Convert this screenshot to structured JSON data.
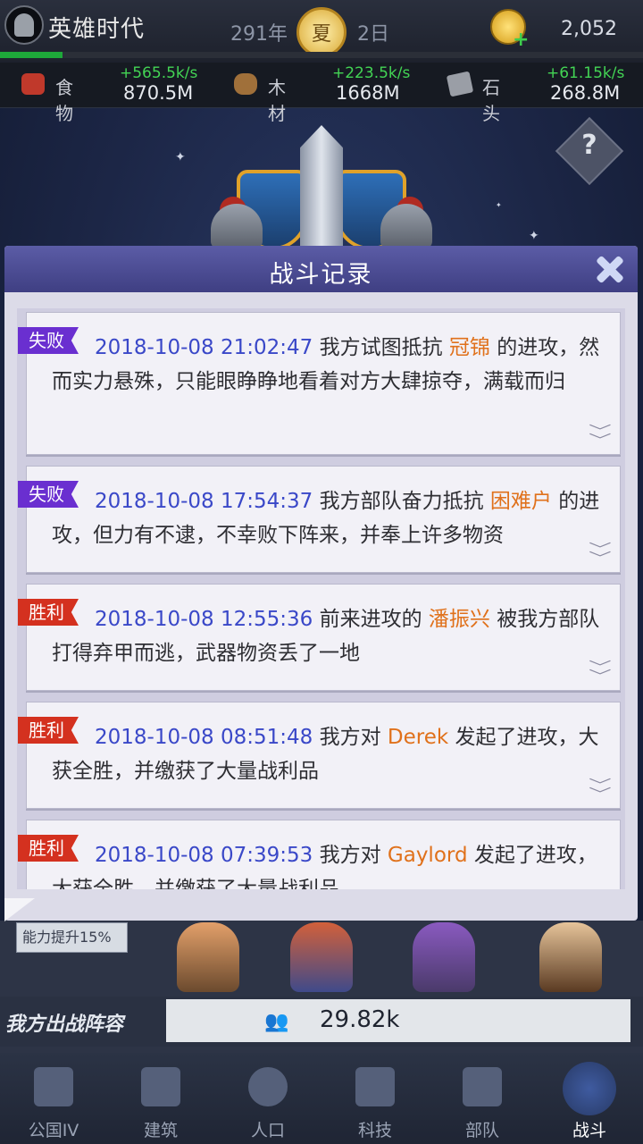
{
  "header": {
    "game_title": "英雄时代",
    "year": "291年",
    "season": "夏",
    "day": "2日",
    "gold": "2,052"
  },
  "resources": [
    {
      "name": "食物",
      "rate": "+565.5k/s",
      "amount": "870.5M",
      "icon": "food-icon"
    },
    {
      "name": "木材",
      "rate": "+223.5k/s",
      "amount": "1668M",
      "icon": "wood-icon"
    },
    {
      "name": "石头",
      "rate": "+61.15k/s",
      "amount": "268.8M",
      "icon": "stone-icon"
    }
  ],
  "help": {
    "label": "?"
  },
  "modal": {
    "title": "战斗记录",
    "entries": [
      {
        "result": "失败",
        "time": "2018-10-08 21:02:47",
        "pre": " 我方试图抵抗 ",
        "name": "冠锦",
        "post": " 的进攻，然而实力悬殊，只能眼睁睁地看着对方大肆掠夺，满载而归"
      },
      {
        "result": "失败",
        "time": "2018-10-08 17:54:37",
        "pre": " 我方部队奋力抵抗 ",
        "name": "困难户",
        "post": " 的进攻，但力有不逮，不幸败下阵来，并奉上许多物资"
      },
      {
        "result": "胜利",
        "time": "2018-10-08 12:55:36",
        "pre": " 前来进攻的 ",
        "name": "潘振兴",
        "post": " 被我方部队打得弃甲而逃，武器物资丢了一地"
      },
      {
        "result": "胜利",
        "time": "2018-10-08 08:51:48",
        "pre": " 我方对 ",
        "name": "Derek",
        "post": " 发起了进攻，大获全胜，并缴获了大量战利品"
      },
      {
        "result": "胜利",
        "time": "2018-10-08 07:39:53",
        "pre": " 我方对 ",
        "name": "Gaylord",
        "post": " 发起了进攻，大获全胜，并缴获了大量战利品"
      }
    ]
  },
  "boost_label": "能力提升15%",
  "lineup": {
    "label": "我方出战阵容",
    "power": "29.82k"
  },
  "nav": [
    {
      "label": "公国IV",
      "icon": "castle-icon"
    },
    {
      "label": "建筑",
      "icon": "house-icon"
    },
    {
      "label": "人口",
      "icon": "person-icon"
    },
    {
      "label": "科技",
      "icon": "book-icon"
    },
    {
      "label": "部队",
      "icon": "banner-icon"
    },
    {
      "label": "战斗",
      "icon": "crossed-swords-icon",
      "active": true
    }
  ],
  "colors": {
    "lose_badge": "#6a2fd0",
    "win_badge": "#d4311f",
    "timestamp": "#3a48c8",
    "player_name": "#e0711b",
    "rate": "#43d454",
    "modal_header": "#4b4c95"
  }
}
